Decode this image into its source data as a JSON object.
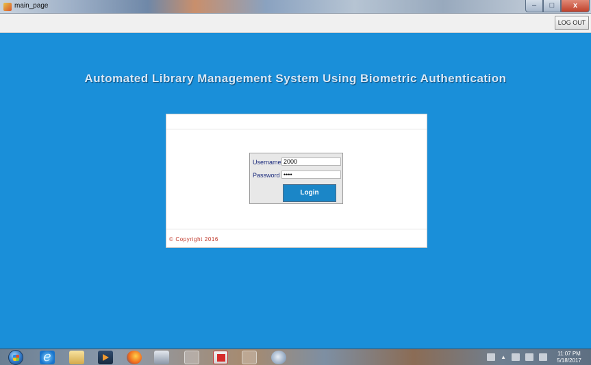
{
  "window": {
    "title": "main_page",
    "controls": {
      "minimize": "–",
      "maximize": "□",
      "close": "x"
    }
  },
  "menu": {
    "logout_label": "LOG OUT"
  },
  "app_title": "Automated Library Management System Using Biometric Authentication",
  "login_form": {
    "username_label": "Username",
    "username_value": "2000",
    "password_label": "Password",
    "password_value": "••••",
    "login_button_label": "Login"
  },
  "footer": {
    "copyright": "© Copyright 2016"
  },
  "taskbar": {
    "clock_time": "11:07 PM",
    "clock_date": "5/18/2017",
    "tray_arrow": "▲",
    "pinned_icons": [
      "windows-start-icon",
      "internet-explorer-icon",
      "folder-icon",
      "media-player-icon",
      "firefox-icon",
      "app-icon",
      "word-icon",
      "pdf-icon",
      "document-icon",
      "tools-icon"
    ]
  },
  "colors": {
    "background": "#1a8fd9",
    "login_button": "#1b86c7",
    "copyright_text": "#c0392b",
    "label_text": "#1a2a7c"
  }
}
